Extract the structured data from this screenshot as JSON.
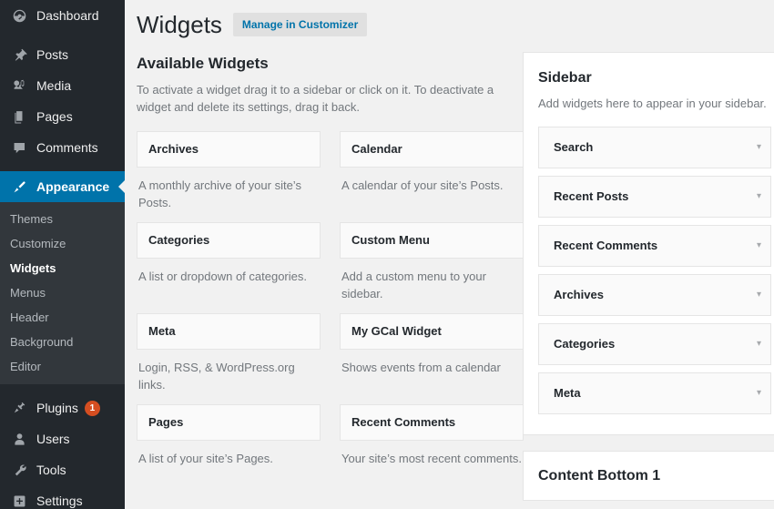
{
  "colors": {
    "admin_bg": "#23282d",
    "admin_submenu_bg": "#32373c",
    "accent_blue": "#0073aa",
    "badge_orange": "#d54e21",
    "page_bg": "#f1f1f1",
    "box_bg": "#fafafa",
    "border": "#e5e5e5",
    "muted_text": "#72777c",
    "dark_text": "#23282d"
  },
  "admin_menu": {
    "items": [
      {
        "label": "Dashboard",
        "icon": "dashboard-gauge-icon",
        "name": "sidebar-item-dashboard",
        "current": false,
        "spacer_above": false
      },
      {
        "label": "Posts",
        "icon": "pushpin-icon",
        "name": "sidebar-item-posts",
        "current": false,
        "spacer_above": true
      },
      {
        "label": "Media",
        "icon": "media-note-icon",
        "name": "sidebar-item-media",
        "current": false,
        "spacer_above": false
      },
      {
        "label": "Pages",
        "icon": "pages-stack-icon",
        "name": "sidebar-item-pages",
        "current": false,
        "spacer_above": false
      },
      {
        "label": "Comments",
        "icon": "comment-bubble-icon",
        "name": "sidebar-item-comments",
        "current": false,
        "spacer_above": false
      },
      {
        "label": "Appearance",
        "icon": "paintbrush-icon",
        "name": "sidebar-item-appearance",
        "current": true,
        "spacer_above": true
      }
    ],
    "appearance_submenu": [
      {
        "label": "Themes",
        "name": "submenu-item-themes",
        "current": false
      },
      {
        "label": "Customize",
        "name": "submenu-item-customize",
        "current": false
      },
      {
        "label": "Widgets",
        "name": "submenu-item-widgets",
        "current": true
      },
      {
        "label": "Menus",
        "name": "submenu-item-menus",
        "current": false
      },
      {
        "label": "Header",
        "name": "submenu-item-header",
        "current": false
      },
      {
        "label": "Background",
        "name": "submenu-item-background",
        "current": false
      },
      {
        "label": "Editor",
        "name": "submenu-item-editor",
        "current": false
      }
    ],
    "items_after": [
      {
        "label": "Plugins",
        "icon": "plug-icon",
        "name": "sidebar-item-plugins",
        "badge": "1"
      },
      {
        "label": "Users",
        "icon": "user-icon",
        "name": "sidebar-item-users",
        "badge": ""
      },
      {
        "label": "Tools",
        "icon": "wrench-icon",
        "name": "sidebar-item-tools",
        "badge": ""
      },
      {
        "label": "Settings",
        "icon": "settings-sliders-icon",
        "name": "sidebar-item-settings",
        "badge": ""
      }
    ]
  },
  "page": {
    "title": "Widgets",
    "customizer_button": "Manage in Customizer",
    "available_heading": "Available Widgets",
    "available_description": "To activate a widget drag it to a sidebar or click on it. To deactivate a widget and delete its settings, drag it back."
  },
  "available_widgets": [
    {
      "title": "Archives",
      "description": "A monthly archive of your site’s Posts."
    },
    {
      "title": "Calendar",
      "description": "A calendar of your site’s Posts."
    },
    {
      "title": "Categories",
      "description": "A list or dropdown of categories."
    },
    {
      "title": "Custom Menu",
      "description": "Add a custom menu to your sidebar."
    },
    {
      "title": "Meta",
      "description": "Login, RSS, & WordPress.org links."
    },
    {
      "title": "My GCal Widget",
      "description": "Shows events from a calendar"
    },
    {
      "title": "Pages",
      "description": "A list of your site’s Pages."
    },
    {
      "title": "Recent Comments",
      "description": "Your site’s most recent comments."
    }
  ],
  "sidebar_panel": {
    "title": "Sidebar",
    "description": "Add widgets here to appear in your sidebar.",
    "widgets": [
      {
        "title": "Search",
        "chevron": "▾"
      },
      {
        "title": "Recent Posts",
        "chevron": "▾"
      },
      {
        "title": "Recent Comments",
        "chevron": "▾"
      },
      {
        "title": "Archives",
        "chevron": "▾"
      },
      {
        "title": "Categories",
        "chevron": "▾"
      },
      {
        "title": "Meta",
        "chevron": "▾"
      }
    ]
  },
  "content_bottom_panel": {
    "title": "Content Bottom 1"
  }
}
